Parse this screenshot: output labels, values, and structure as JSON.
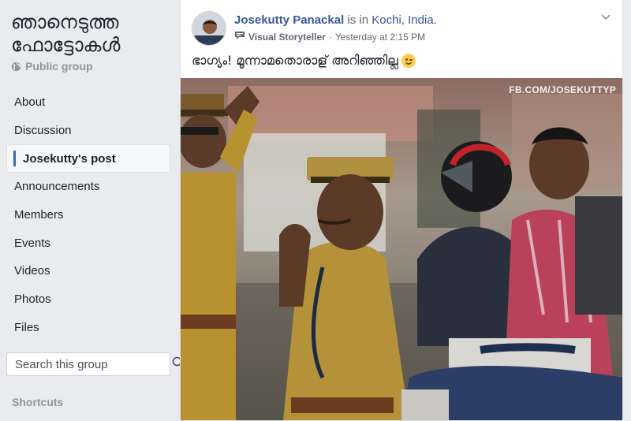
{
  "group": {
    "name": "ഞാനെടുത്ത ഫോട്ടോകൾ",
    "privacy": "Public group"
  },
  "nav": {
    "items": [
      {
        "label": "About"
      },
      {
        "label": "Discussion"
      },
      {
        "label": "Josekutty's post",
        "active": true
      },
      {
        "label": "Announcements"
      },
      {
        "label": "Members"
      },
      {
        "label": "Events"
      },
      {
        "label": "Videos"
      },
      {
        "label": "Photos"
      },
      {
        "label": "Files"
      }
    ]
  },
  "search": {
    "placeholder": "Search this group"
  },
  "shortcuts_label": "Shortcuts",
  "post": {
    "author": "Josekutty Panackal",
    "connector": "is in",
    "location": "Kochi, India.",
    "badge": "Visual Storyteller",
    "timestamp": "Yesterday at 2:15 PM",
    "text": "ഭാഗ്യം! മൂന്നാമതൊരാള് അറിഞ്ഞില്ല",
    "photo_watermark": "FB.COM/JOSEKUTTYP"
  },
  "colors": {
    "link": "#385898",
    "accent": "#4267b2",
    "background": "#e9ebee",
    "muted": "#90949c"
  },
  "icons": {
    "privacy": "globe-icon",
    "search": "search-icon",
    "badge": "chat-bubble-icon",
    "menu": "chevron-down-icon"
  }
}
